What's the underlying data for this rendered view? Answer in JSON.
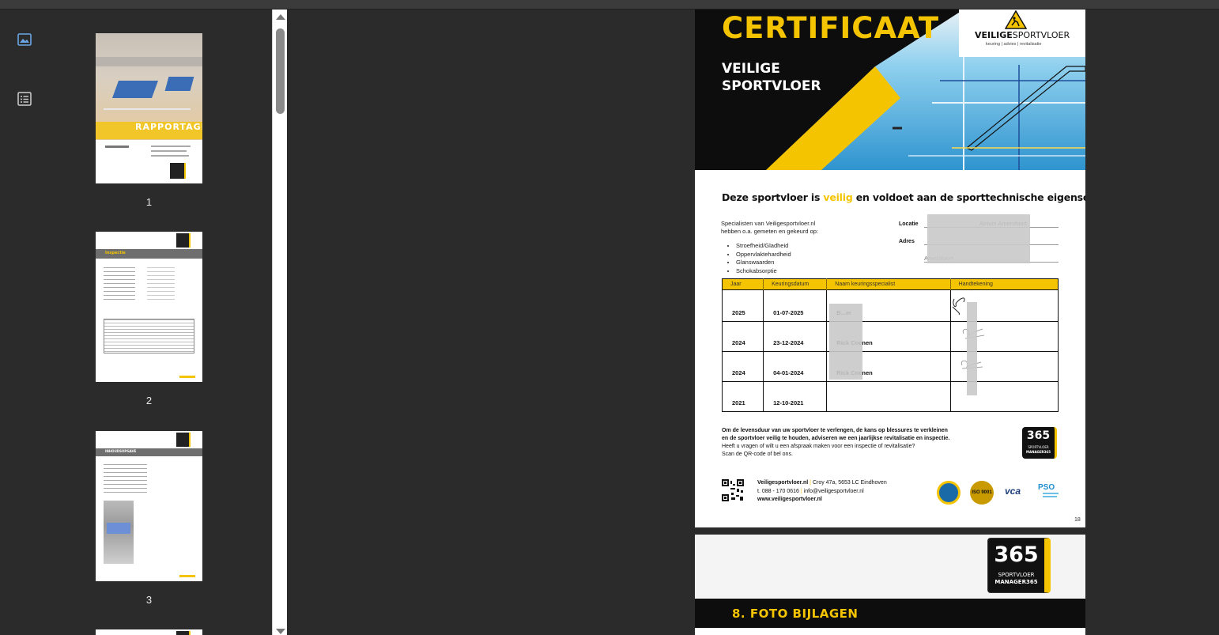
{
  "sidebar": {
    "thumbnails_view_icon": "image-icon",
    "outline_view_icon": "list-icon",
    "pages": [
      {
        "num": "1",
        "title": "RAPPORTAGE"
      },
      {
        "num": "2",
        "title": "Inspectie"
      },
      {
        "num": "3",
        "title": "INHOUDSOPGAVE"
      }
    ]
  },
  "certificate": {
    "title": "CERTIFICAAT",
    "subtitle_line1": "VEILIGE",
    "subtitle_line2": "SPORTVLOER",
    "brand_bold": "VEILIGE",
    "brand_rest": "SPORTVLOER",
    "brand_tagline": "keuring | advies | revitalisatie",
    "headline_before": "Deze sportvloer is ",
    "headline_highlight": "veilig",
    "headline_after": " en voldoet aan de sporttechnische eigenschappen!",
    "intro_line1": "Specialisten van Veiligesportvloer.nl",
    "intro_line2": "hebben o.a. gemeten en gekeurd op:",
    "checks": [
      "Stroefheid/Gladheid",
      "Oppervlaktehardheid",
      "Glanswaarden",
      "Schokabsorptie"
    ],
    "location_label": "Locatie",
    "location_value": "Atrium Amersfoort",
    "address_label": "Adres",
    "address_value": "",
    "city_value": "Amersfoort",
    "table_headers": [
      "Jaar",
      "Keuringsdatum",
      "Naam keuringsspecialist",
      "Handtekening"
    ],
    "table_rows": [
      {
        "year": "2025",
        "date": "01-07-2025",
        "name": "B...er"
      },
      {
        "year": "2024",
        "date": "23-12-2024",
        "name": "Rick Coenen"
      },
      {
        "year": "2024",
        "date": "04-01-2024",
        "name": "Rick Coenen"
      },
      {
        "year": "2021",
        "date": "12-10-2021",
        "name": ""
      }
    ],
    "advice_bold1": "Om de levensduur van uw sportvloer te verlengen, de kans op blessures te verkleinen",
    "advice_bold2": "en de sportvloer veilig te houden, adviseren we een jaarlijkse revitalisatie en inspectie.",
    "advice_line3": "Heeft u vragen of wilt u een afspraak maken voor een inspectie of revitalisatie?",
    "advice_line4": "Scan de QR-code of bel ons.",
    "footer_site": "Veiligesportvloer.nl",
    "footer_address": "Croy 47a, 5653 LC Eindhoven",
    "footer_phone": "t. 088 - 170 0616",
    "footer_email": "info@veiligesportvloer.nl",
    "footer_www": "www.veiligesportvloer.nl",
    "iso_label": "ISO 9001",
    "vca_label": "vca",
    "pso_label": "PSO",
    "page_number": "18"
  },
  "badge": {
    "number": "365",
    "line1": "SPORTVLOER",
    "line2": "MANAGER365"
  },
  "next_page": {
    "section_title": "8. FOTO BIJLAGEN"
  },
  "colors": {
    "accent_yellow": "#f5c400",
    "black": "#111111",
    "court_blue": "#3aa0d8"
  }
}
